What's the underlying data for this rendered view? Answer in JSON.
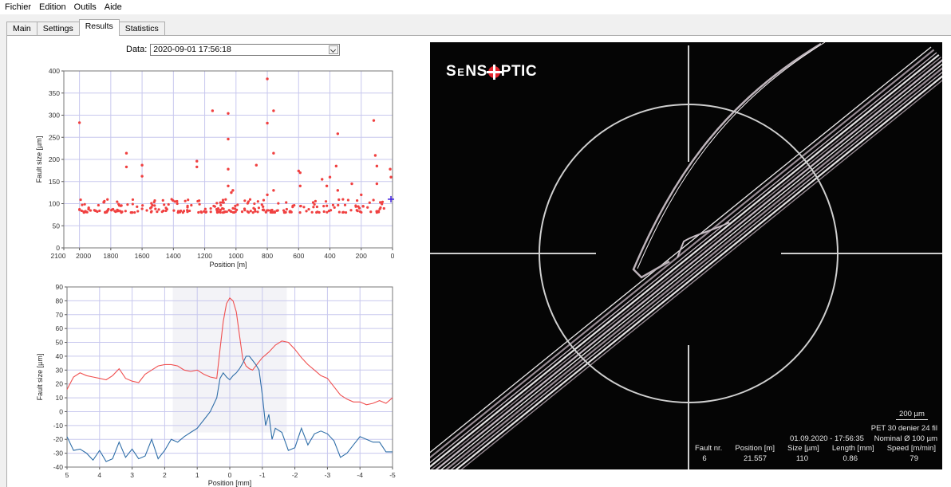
{
  "menu": [
    "Fichier",
    "Edition",
    "Outils",
    "Aide"
  ],
  "tabs": [
    {
      "label": "Main",
      "active": false
    },
    {
      "label": "Settings",
      "active": false
    },
    {
      "label": "Results",
      "active": true
    },
    {
      "label": "Statistics",
      "active": false
    }
  ],
  "data_selector": {
    "label": "Data:",
    "value": "2020-09-01 17:56:18"
  },
  "chart_data": [
    {
      "type": "scatter",
      "xlabel": "Position [m]",
      "ylabel": "Fault size [µm]",
      "xlim": [
        2100,
        0
      ],
      "ylim": [
        0,
        400
      ],
      "xticks": [
        "2100",
        "2000",
        "1800",
        "1600",
        "1400",
        "1200",
        "1000",
        "800",
        "600",
        "400",
        "200",
        "0"
      ],
      "yticks": [
        "0",
        "50",
        "100",
        "150",
        "200",
        "250",
        "300",
        "350",
        "400"
      ],
      "grid": true,
      "outliers": [
        [
          2000,
          283
        ],
        [
          1700,
          214
        ],
        [
          1700,
          183
        ],
        [
          1600,
          187
        ],
        [
          1600,
          162
        ],
        [
          1250,
          196
        ],
        [
          1250,
          183
        ],
        [
          1150,
          310
        ],
        [
          1050,
          304
        ],
        [
          1050,
          246
        ],
        [
          1050,
          178
        ],
        [
          1050,
          140
        ],
        [
          1030,
          125
        ],
        [
          1020,
          130
        ],
        [
          870,
          187
        ],
        [
          800,
          382
        ],
        [
          800,
          282
        ],
        [
          800,
          120
        ],
        [
          760,
          310
        ],
        [
          760,
          214
        ],
        [
          760,
          130
        ],
        [
          600,
          174
        ],
        [
          590,
          170
        ],
        [
          590,
          140
        ],
        [
          450,
          155
        ],
        [
          420,
          140
        ],
        [
          400,
          160
        ],
        [
          360,
          185
        ],
        [
          350,
          258
        ],
        [
          350,
          130
        ],
        [
          260,
          145
        ],
        [
          200,
          120
        ],
        [
          120,
          288
        ],
        [
          110,
          209
        ],
        [
          100,
          185
        ],
        [
          100,
          145
        ],
        [
          15,
          178
        ],
        [
          10,
          160
        ]
      ],
      "baseline": {
        "from": 2000,
        "to": 0,
        "min": 80,
        "max": 110,
        "count": 260
      },
      "cursor": [
        10,
        110
      ]
    },
    {
      "type": "line",
      "xlabel": "Position [mm]",
      "ylabel": "Fault size [µm]",
      "xlim": [
        5,
        -5
      ],
      "ylim": [
        -40,
        90
      ],
      "xticks": [
        "5",
        "4",
        "3",
        "2",
        "1",
        "0",
        "-1",
        "-2",
        "-3",
        "-4",
        "-5"
      ],
      "yticks": [
        "-40",
        "-30",
        "-20",
        "-10",
        "0",
        "10",
        "20",
        "30",
        "40",
        "50",
        "60",
        "70",
        "80",
        "90"
      ],
      "grid": true,
      "highlight": [
        1.75,
        -1.75
      ],
      "series": [
        {
          "color": "#f05050",
          "x": [
            5,
            4.8,
            4.6,
            4.4,
            4.2,
            4,
            3.8,
            3.6,
            3.4,
            3.2,
            3,
            2.8,
            2.6,
            2.4,
            2.2,
            2,
            1.8,
            1.6,
            1.4,
            1.2,
            1,
            0.8,
            0.6,
            0.4,
            0.3,
            0.2,
            0.1,
            0,
            -0.1,
            -0.2,
            -0.3,
            -0.4,
            -0.5,
            -0.6,
            -0.7,
            -0.8,
            -1,
            -1.2,
            -1.4,
            -1.6,
            -1.8,
            -2,
            -2.2,
            -2.4,
            -2.6,
            -2.8,
            -3,
            -3.2,
            -3.4,
            -3.6,
            -3.8,
            -4,
            -4.2,
            -4.4,
            -4.6,
            -4.8,
            -5
          ],
          "y": [
            16,
            25,
            28,
            26,
            25,
            24,
            23,
            26,
            31,
            24,
            22,
            21,
            27,
            30,
            33,
            34,
            34,
            33,
            30,
            29,
            30,
            27,
            25,
            24,
            45,
            65,
            78,
            82,
            80,
            72,
            55,
            38,
            33,
            31,
            30,
            33,
            39,
            43,
            48,
            51,
            50,
            45,
            39,
            34,
            30,
            26,
            24,
            18,
            12,
            9,
            7,
            7,
            5,
            6,
            8,
            6,
            10
          ]
        },
        {
          "color": "#2f6ea8",
          "x": [
            5,
            4.8,
            4.6,
            4.4,
            4.2,
            4,
            3.8,
            3.6,
            3.4,
            3.2,
            3,
            2.8,
            2.6,
            2.4,
            2.2,
            2,
            1.8,
            1.6,
            1.4,
            1.2,
            1,
            0.8,
            0.6,
            0.4,
            0.3,
            0.2,
            0.1,
            0,
            -0.1,
            -0.2,
            -0.3,
            -0.4,
            -0.5,
            -0.6,
            -0.7,
            -0.8,
            -0.9,
            -1,
            -1.1,
            -1.2,
            -1.3,
            -1.4,
            -1.6,
            -1.8,
            -2,
            -2.2,
            -2.4,
            -2.6,
            -2.8,
            -3,
            -3.2,
            -3.4,
            -3.6,
            -3.8,
            -4,
            -4.2,
            -4.4,
            -4.6,
            -4.8,
            -5
          ],
          "y": [
            -18,
            -28,
            -27,
            -30,
            -35,
            -28,
            -36,
            -34,
            -22,
            -33,
            -27,
            -34,
            -32,
            -20,
            -34,
            -28,
            -20,
            -22,
            -18,
            -15,
            -12,
            -6,
            0,
            10,
            24,
            28,
            25,
            23,
            26,
            28,
            31,
            35,
            40,
            40,
            37,
            34,
            30,
            12,
            -10,
            -2,
            -20,
            -12,
            -15,
            -28,
            -26,
            -12,
            -24,
            -16,
            -14,
            -16,
            -21,
            -33,
            -30,
            -24,
            -18,
            -20,
            -22,
            -22,
            -29,
            -29
          ]
        }
      ]
    }
  ],
  "image_view": {
    "logo_left": "S",
    "logo_e": "E",
    "logo_mid": "NS",
    "logo_right": "PTIC",
    "scale_bar": "200 µm",
    "material": "PET 30 denier 24 fil",
    "datetime": "01.09.2020 - 17:56:35",
    "nominal": "Nominal Ø 100 µm",
    "table_headers": [
      "Fault nr.",
      "Position [m]",
      "Size [µm]",
      "Length [mm]",
      "Speed [m/min]"
    ],
    "table_values": [
      "6",
      "21.557",
      "110",
      "0.86",
      "79"
    ]
  },
  "colors": {
    "scatter_points": "#f04040",
    "cursor": "#4020e0",
    "overlay": "#d9d9d9"
  }
}
